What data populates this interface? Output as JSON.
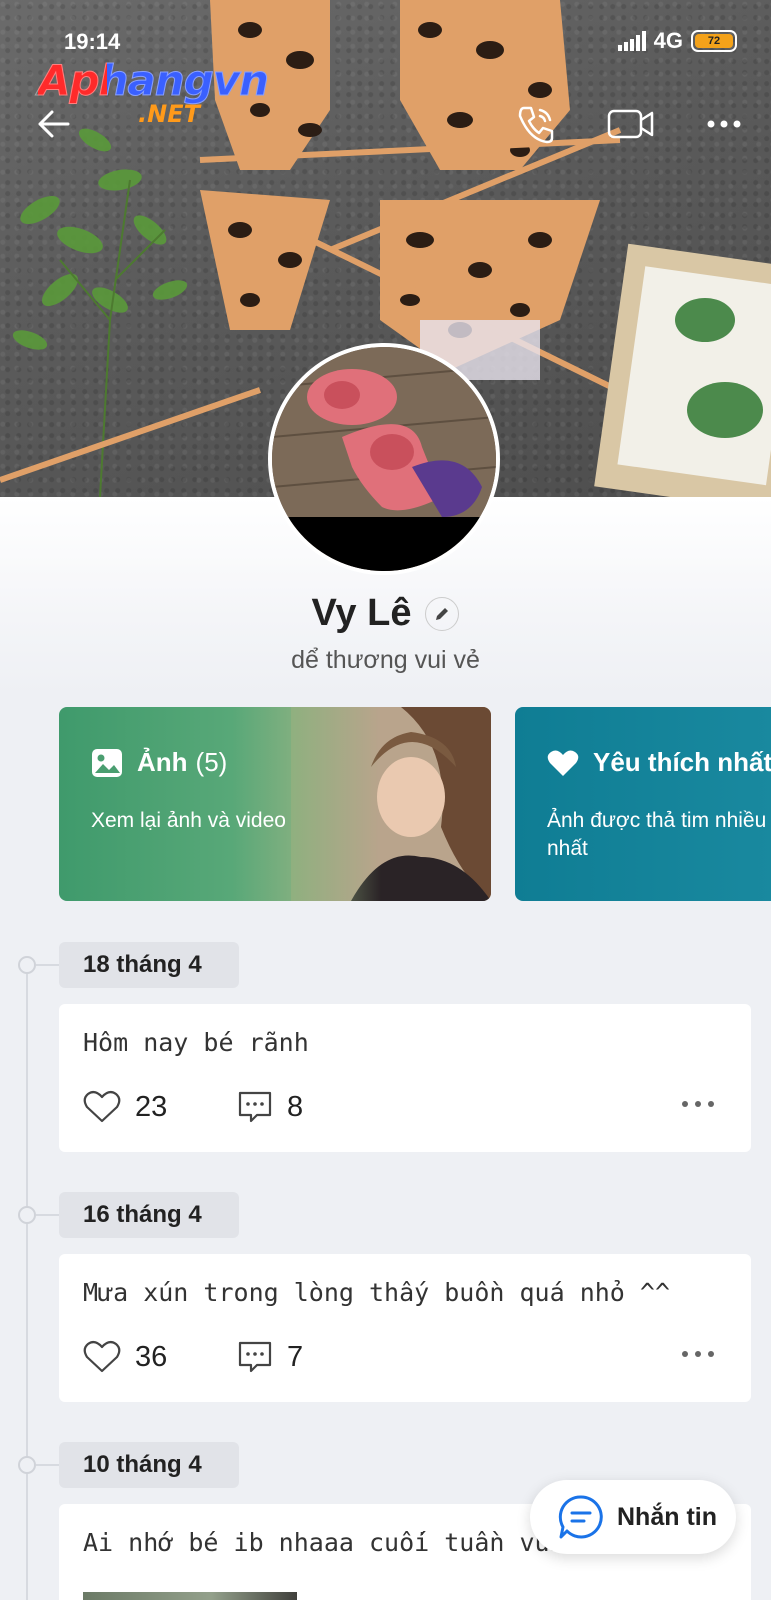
{
  "status_bar": {
    "time": "19:14",
    "network": "4G",
    "battery": "72"
  },
  "watermark": {
    "main": "Aphangvn",
    "sub": ".NET"
  },
  "nav": {
    "back_icon": "arrow-left-icon",
    "call_icon": "phone-icon",
    "video_icon": "video-camera-icon",
    "more_icon": "more-dots-icon"
  },
  "profile": {
    "name": "Vy Lê",
    "status": "dể thương vui vẻ"
  },
  "cards": {
    "photos": {
      "title": "Ảnh",
      "count": "(5)",
      "subtitle": "Xem lại ảnh và video"
    },
    "favorites": {
      "title": "Yêu thích nhất",
      "subtitle": "Ảnh được thả tim nhiều nhất"
    }
  },
  "timeline": [
    {
      "date": "18 tháng 4",
      "text": "Hôm nay bé rãnh",
      "likes": "23",
      "comments": "8"
    },
    {
      "date": "16 tháng 4",
      "text": "Mưa xún trong lòng thấy buồn quá nhỏ ^^",
      "likes": "36",
      "comments": "7"
    },
    {
      "date": "10 tháng 4",
      "text": "Ai nhớ bé ib nhaaa cuối tuần vui vẻ ^^"
    }
  ],
  "message_button": {
    "label": "Nhắn tin"
  },
  "colors": {
    "accent": "#1a73e8",
    "photos_card": "#3f9a6c",
    "favorites_card": "#0f7d94",
    "battery": "#f4a21a"
  }
}
